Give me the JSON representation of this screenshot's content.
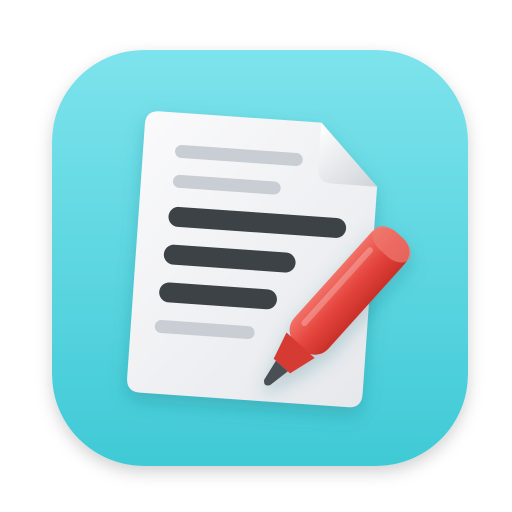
{
  "icon": {
    "semantic": "document-with-marker-app-icon",
    "colors": {
      "background_light": "#7DE3EC",
      "background_dark": "#3FCAD6",
      "paper": "#F1F2F4",
      "paper_fold": "#D9DCE1",
      "text_line_light": "#C9CDD4",
      "text_line_dark": "#3D4246",
      "marker_body": "#E5453E",
      "marker_highlight": "#F07A70",
      "marker_tip": "#4A4F55"
    }
  }
}
